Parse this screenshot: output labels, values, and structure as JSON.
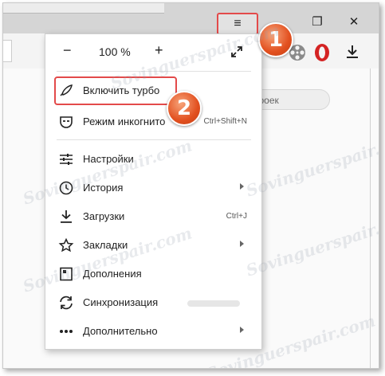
{
  "window": {
    "menu_button_icon": "hamburger-icon",
    "menu_button_glyph": "≡",
    "restore_glyph": "❐",
    "close_glyph": "✕"
  },
  "toolbar_icons": [
    "film-reel-icon",
    "opera-icon",
    "download-icon"
  ],
  "content": {
    "search_pill_text": "троек"
  },
  "menu": {
    "zoom": {
      "minus": "−",
      "value": "100 %",
      "plus": "+",
      "fullscreen_icon": "fullscreen-icon"
    },
    "items": [
      {
        "label": "Включить турбо",
        "icon": "rocket-icon",
        "glyph": "🚀"
      },
      {
        "label": "Режим инкогнито",
        "shortcut": "Ctrl+Shift+N",
        "icon": "incognito-icon",
        "glyph": "🕶"
      },
      {
        "label": "Настройки",
        "icon": "settings-sliders-icon",
        "glyph": "☰"
      },
      {
        "label": "История",
        "icon": "clock-icon",
        "glyph": "🕓"
      },
      {
        "label": "Загрузки",
        "shortcut": "Ctrl+J",
        "icon": "download-icon",
        "glyph": "⤓"
      },
      {
        "label": "Закладки",
        "icon": "star-icon",
        "glyph": "☆"
      },
      {
        "label": "Дополнения",
        "icon": "extensions-icon",
        "glyph": "▣"
      },
      {
        "label": "Синхронизация",
        "icon": "sync-icon",
        "glyph": "⟳"
      },
      {
        "label": "Дополнительно",
        "icon": "more-dots-icon",
        "glyph": "⋯"
      }
    ]
  },
  "annotations": {
    "step1": "1",
    "step2": "2",
    "highlight_color": "#e34a4a",
    "badge_color": "#e2501f"
  },
  "watermark_text": "Sovinguerspair.com"
}
